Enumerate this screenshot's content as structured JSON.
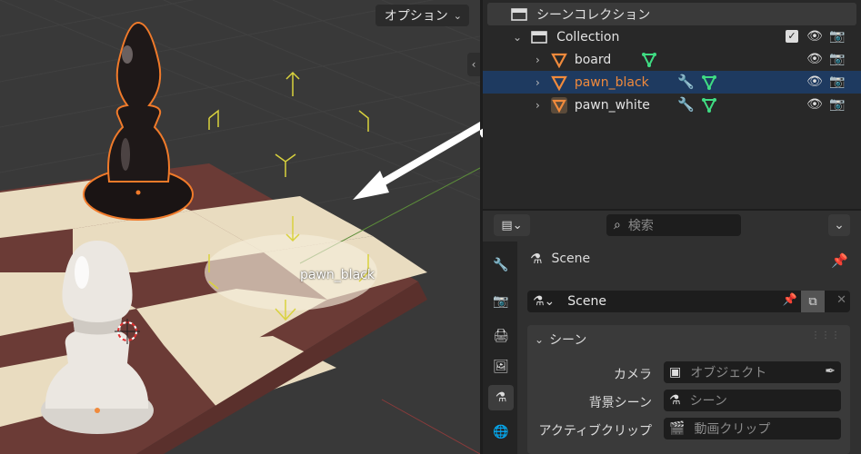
{
  "viewport": {
    "options_label": "オプション",
    "object_label": "pawn_black"
  },
  "outliner": {
    "scene_collection_label": "シーンコレクション",
    "collection_label": "Collection",
    "items": [
      {
        "label": "board",
        "selected": false,
        "color": "#e2e2e2"
      },
      {
        "label": "pawn_black",
        "selected": true,
        "color": "#f08a3c"
      },
      {
        "label": "pawn_white",
        "selected": false,
        "color": "#e2e2e2"
      }
    ]
  },
  "properties": {
    "search_placeholder": "検索",
    "context_title": "Scene",
    "datablock_name": "Scene",
    "panel_title": "シーン",
    "fields": [
      {
        "label": "カメラ",
        "value": "オブジェクト",
        "icon": "camera-object-icon"
      },
      {
        "label": "背景シーン",
        "value": "シーン",
        "icon": "scene-icon"
      },
      {
        "label": "アクティブクリップ",
        "value": "動画クリップ",
        "icon": "clip-icon"
      }
    ]
  },
  "colors": {
    "selection": "#f08a3c",
    "selected_row": "#1e3a60",
    "accent_green": "#3fdc83",
    "accent_blue": "#6aa7ff"
  }
}
